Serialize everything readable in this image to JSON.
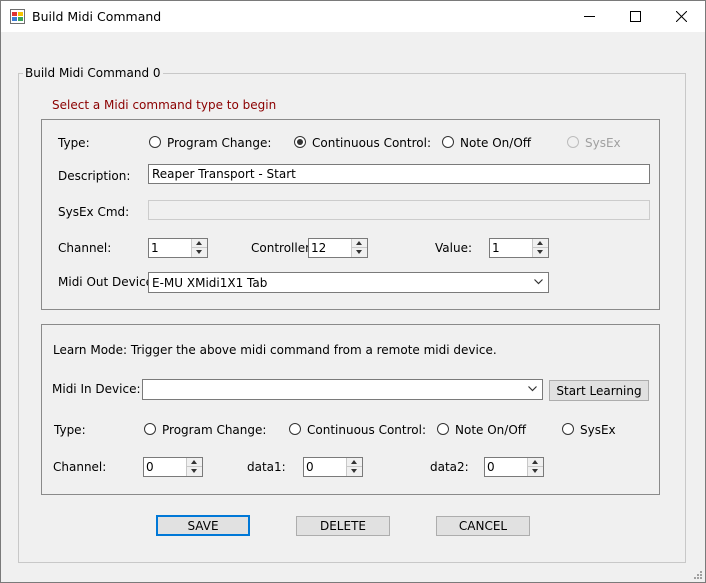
{
  "window": {
    "title": "Build Midi Command"
  },
  "group": {
    "title": "Build Midi Command 0",
    "hint": "Select a Midi command type to begin",
    "hint_color": "#8b0000"
  },
  "command": {
    "type_label": "Type:",
    "types": [
      {
        "label": "Program Change:",
        "checked": false,
        "disabled": false
      },
      {
        "label": "Continuous Control:",
        "checked": true,
        "disabled": false
      },
      {
        "label": "Note On/Off",
        "checked": false,
        "disabled": false
      },
      {
        "label": "SysEx",
        "checked": false,
        "disabled": true
      }
    ],
    "description_label": "Description:",
    "description_value": "Reaper Transport - Start",
    "sysex_label": "SysEx Cmd:",
    "sysex_value": "",
    "channel_label": "Channel:",
    "channel_value": "1",
    "controller_label": "Controller:",
    "controller_value": "12",
    "value_label": "Value:",
    "value_value": "1",
    "midi_out_label": "Midi Out Device:",
    "midi_out_value": "E-MU XMidi1X1 Tab"
  },
  "learn": {
    "instruction": "Learn Mode: Trigger the above midi command from a remote midi device.",
    "midi_in_label": "Midi In Device:",
    "midi_in_value": "",
    "start_label": "Start Learning",
    "type_label": "Type:",
    "types": [
      {
        "label": "Program Change:",
        "checked": false
      },
      {
        "label": "Continuous Control:",
        "checked": false
      },
      {
        "label": "Note On/Off",
        "checked": false
      },
      {
        "label": "SysEx",
        "checked": false
      }
    ],
    "channel_label": "Channel:",
    "channel_value": "0",
    "data1_label": "data1:",
    "data1_value": "0",
    "data2_label": "data2:",
    "data2_value": "0"
  },
  "buttons": {
    "save": "SAVE",
    "delete": "DELETE",
    "cancel": "CANCEL"
  },
  "colors": {
    "disabled_text": "#a0a0a0",
    "default_button_border": "#0078d7"
  }
}
